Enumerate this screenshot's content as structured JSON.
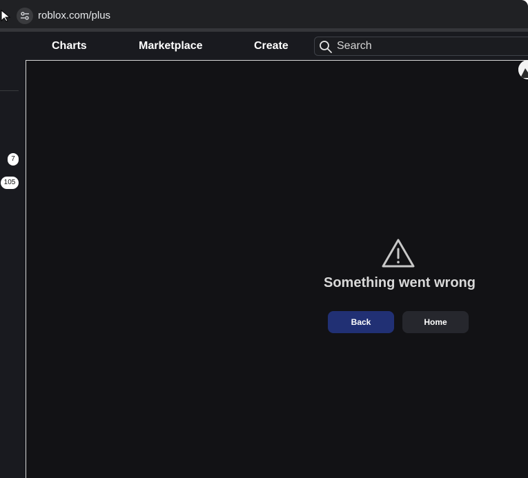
{
  "browser": {
    "url": "roblox.com/plus",
    "site_info_icon": "tune-icon",
    "cursor_icon": "pointer-cursor-icon"
  },
  "header": {
    "nav": [
      {
        "label": "Charts"
      },
      {
        "label": "Marketplace"
      },
      {
        "label": "Create"
      }
    ],
    "search": {
      "placeholder": "Search",
      "value": "",
      "icon": "search-icon"
    }
  },
  "left_rail": {
    "badges": [
      "7",
      "105"
    ]
  },
  "error": {
    "icon": "warning-triangle-icon",
    "title": "Something went wrong",
    "back_label": "Back",
    "home_label": "Home"
  },
  "colors": {
    "page_background": "#121215",
    "header_background": "#191a1f",
    "back_button": "#213074",
    "home_button": "#26272d",
    "error_text": "#d9d9d9"
  }
}
